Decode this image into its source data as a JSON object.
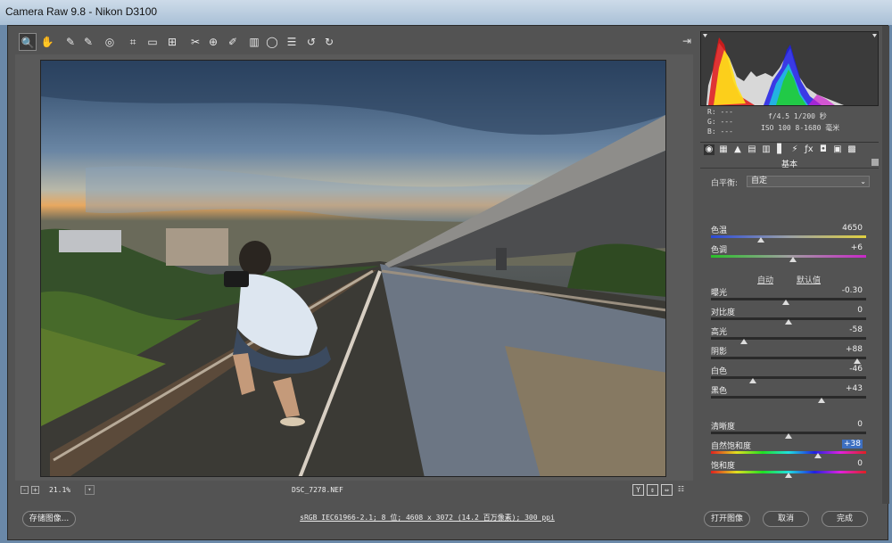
{
  "window": {
    "title": "Camera Raw 9.8  -  Nikon D3100"
  },
  "toolbar": {
    "tools": [
      {
        "name": "zoom-tool-icon",
        "glyph": "🔍"
      },
      {
        "name": "hand-tool-icon",
        "glyph": "✋"
      },
      {
        "name": "white-balance-tool-icon",
        "glyph": "✎"
      },
      {
        "name": "color-sampler-tool-icon",
        "glyph": "✎"
      },
      {
        "name": "targeted-adjustment-tool-icon",
        "glyph": "◎"
      },
      {
        "name": "crop-tool-icon",
        "glyph": "⌗"
      },
      {
        "name": "straighten-tool-icon",
        "glyph": "▭"
      },
      {
        "name": "transform-tool-icon",
        "glyph": "⊞"
      },
      {
        "name": "spot-removal-tool-icon",
        "glyph": "✂"
      },
      {
        "name": "red-eye-tool-icon",
        "glyph": "⊕"
      },
      {
        "name": "adjustment-brush-icon",
        "glyph": "✐"
      },
      {
        "name": "graduated-filter-icon",
        "glyph": "▥"
      },
      {
        "name": "radial-filter-icon",
        "glyph": "◯"
      },
      {
        "name": "preferences-icon",
        "glyph": "☰"
      },
      {
        "name": "rotate-left-icon",
        "glyph": "↺"
      },
      {
        "name": "rotate-right-icon",
        "glyph": "↻"
      }
    ],
    "open_icon": "⇥"
  },
  "bottombar": {
    "zoom_minus": "-",
    "zoom_plus": "+",
    "zoom": "21.1%",
    "zoom_dropdown": "▾",
    "filename": "DSC_7278.NEF",
    "view_buttons": [
      "Y",
      "⇕",
      "⇔",
      "☷"
    ]
  },
  "footer": {
    "save_label": "存储图像...",
    "workflow_link": "sRGB IEC61966-2.1; 8 位; 4608 x 3072 (14.2 百万像素); 300 ppi",
    "open_label": "打开图像",
    "cancel_label": "取消",
    "done_label": "完成"
  },
  "readout": {
    "r": "R:  ---",
    "g": "G:  ---",
    "b": "B:  ---",
    "aperture": "f/4.5  1/200 秒",
    "iso": "ISO 100  8-1680 毫米"
  },
  "panel": {
    "tabs": [
      "◉",
      "▦",
      "▲",
      "▤",
      "▥",
      "▋",
      "⚡",
      "ƒx",
      "◘",
      "▣",
      "▩"
    ],
    "section_title": "基本",
    "white_balance_label": "白平衡:",
    "white_balance_value": "自定",
    "white_balance_arrow": "⌄",
    "auto_label": "自动",
    "default_label": "默认值",
    "controls": [
      {
        "id": "temperature",
        "label": "色温",
        "value": "4650",
        "pos": 0.32,
        "track": "temp"
      },
      {
        "id": "tint",
        "label": "色调",
        "value": "+6",
        "pos": 0.53,
        "track": "tint"
      },
      {
        "id": "exposure",
        "label": "曝光",
        "value": "-0.30",
        "pos": 0.48,
        "track": "gray"
      },
      {
        "id": "contrast",
        "label": "对比度",
        "value": "0",
        "pos": 0.5,
        "track": "gray"
      },
      {
        "id": "highlights",
        "label": "高光",
        "value": "-58",
        "pos": 0.21,
        "track": "gray"
      },
      {
        "id": "shadows",
        "label": "阴影",
        "value": "+88",
        "pos": 0.94,
        "track": "gray"
      },
      {
        "id": "whites",
        "label": "白色",
        "value": "-46",
        "pos": 0.27,
        "track": "gray"
      },
      {
        "id": "blacks",
        "label": "黑色",
        "value": "+43",
        "pos": 0.715,
        "track": "gray"
      },
      {
        "id": "clarity",
        "label": "清晰度",
        "value": "0",
        "pos": 0.5,
        "track": "gray"
      },
      {
        "id": "vibrance",
        "label": "自然饱和度",
        "value": "+38",
        "pos": 0.69,
        "track": "sat",
        "highlight": true
      },
      {
        "id": "saturation",
        "label": "饱和度",
        "value": "0",
        "pos": 0.5,
        "track": "sat"
      }
    ]
  },
  "colors": {
    "panel_bg": "#535353",
    "accent": "#3d6fc1"
  }
}
